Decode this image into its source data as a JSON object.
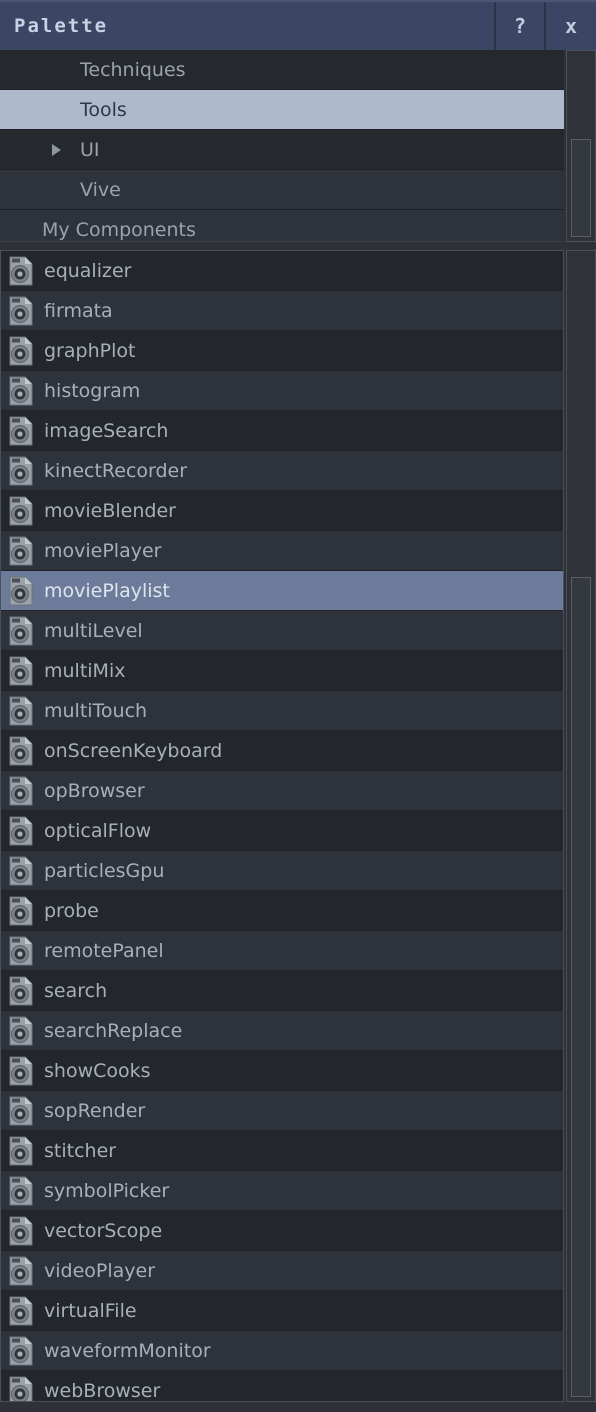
{
  "window": {
    "title": "Palette",
    "help_button": "?",
    "close_button": "x"
  },
  "colors": {
    "titlebar_bg": "#3a4663",
    "title_text": "#c9d2e4",
    "panel_bg": "#24272c",
    "row_odd": "#23262b",
    "row_even": "#2e323a",
    "row_selected_list": "#6c7b99",
    "row_selected_tree": "#aeb9cd",
    "label_text": "#a7b0ba",
    "scrollbar_track": "#2f3339",
    "scrollbar_thumb": "#34383f"
  },
  "tree": {
    "items": [
      {
        "label": "Techniques",
        "indent": 2,
        "selected": false,
        "expandable": false,
        "shade": "dark"
      },
      {
        "label": "Tools",
        "indent": 2,
        "selected": true,
        "expandable": false,
        "shade": "sel"
      },
      {
        "label": "UI",
        "indent": 2,
        "selected": false,
        "expandable": true,
        "shade": "dark"
      },
      {
        "label": "Vive",
        "indent": 2,
        "selected": false,
        "expandable": false,
        "shade": "mid"
      },
      {
        "label": "My Components",
        "indent": 1,
        "selected": false,
        "expandable": false,
        "shade": "root"
      }
    ],
    "scrollbar": {
      "name": "tree-scrollbar"
    }
  },
  "list": {
    "icon_name": "comp-file-icon",
    "items": [
      {
        "label": "equalizer",
        "selected": false
      },
      {
        "label": "firmata",
        "selected": false
      },
      {
        "label": "graphPlot",
        "selected": false
      },
      {
        "label": "histogram",
        "selected": false
      },
      {
        "label": "imageSearch",
        "selected": false
      },
      {
        "label": "kinectRecorder",
        "selected": false
      },
      {
        "label": "movieBlender",
        "selected": false
      },
      {
        "label": "moviePlayer",
        "selected": false
      },
      {
        "label": "moviePlaylist",
        "selected": true
      },
      {
        "label": "multiLevel",
        "selected": false
      },
      {
        "label": "multiMix",
        "selected": false
      },
      {
        "label": "multiTouch",
        "selected": false
      },
      {
        "label": "onScreenKeyboard",
        "selected": false
      },
      {
        "label": "opBrowser",
        "selected": false
      },
      {
        "label": "opticalFlow",
        "selected": false
      },
      {
        "label": "particlesGpu",
        "selected": false
      },
      {
        "label": "probe",
        "selected": false
      },
      {
        "label": "remotePanel",
        "selected": false
      },
      {
        "label": "search",
        "selected": false
      },
      {
        "label": "searchReplace",
        "selected": false
      },
      {
        "label": "showCooks",
        "selected": false
      },
      {
        "label": "sopRender",
        "selected": false
      },
      {
        "label": "stitcher",
        "selected": false
      },
      {
        "label": "symbolPicker",
        "selected": false
      },
      {
        "label": "vectorScope",
        "selected": false
      },
      {
        "label": "videoPlayer",
        "selected": false
      },
      {
        "label": "virtualFile",
        "selected": false
      },
      {
        "label": "waveformMonitor",
        "selected": false
      },
      {
        "label": "webBrowser",
        "selected": false
      }
    ],
    "scrollbar": {
      "name": "list-scrollbar"
    }
  }
}
